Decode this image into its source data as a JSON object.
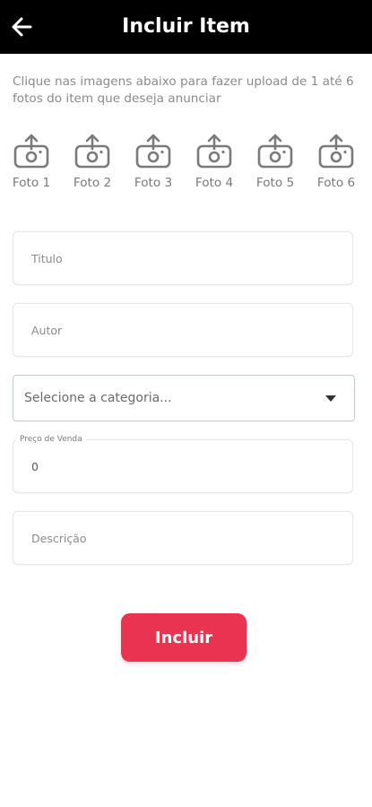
{
  "header": {
    "title": "Incluir Item",
    "back_icon": "arrow-left-icon"
  },
  "instructions": "Clique nas imagens abaixo para fazer upload de 1 até 6 fotos do item que deseja anunciar",
  "photos": {
    "icon": "camera-upload-icon",
    "items": [
      {
        "label": "Foto 1"
      },
      {
        "label": "Foto 2"
      },
      {
        "label": "Foto 3"
      },
      {
        "label": "Foto 4"
      },
      {
        "label": "Foto 5"
      },
      {
        "label": "Foto 6"
      }
    ]
  },
  "form": {
    "title": {
      "placeholder": "Titulo",
      "value": ""
    },
    "author": {
      "placeholder": "Autor",
      "value": ""
    },
    "category": {
      "selected": "Selecione a categoria...",
      "icon": "caret-down-icon"
    },
    "price": {
      "label": "Preço de Venda",
      "value": "0"
    },
    "description": {
      "placeholder": "Descrição",
      "value": ""
    }
  },
  "submit": {
    "label": "Incluir"
  },
  "colors": {
    "header_bg": "#000000",
    "accent": "#e93350",
    "select_border": "#b9cec8",
    "text_muted": "#8a8a8a"
  }
}
